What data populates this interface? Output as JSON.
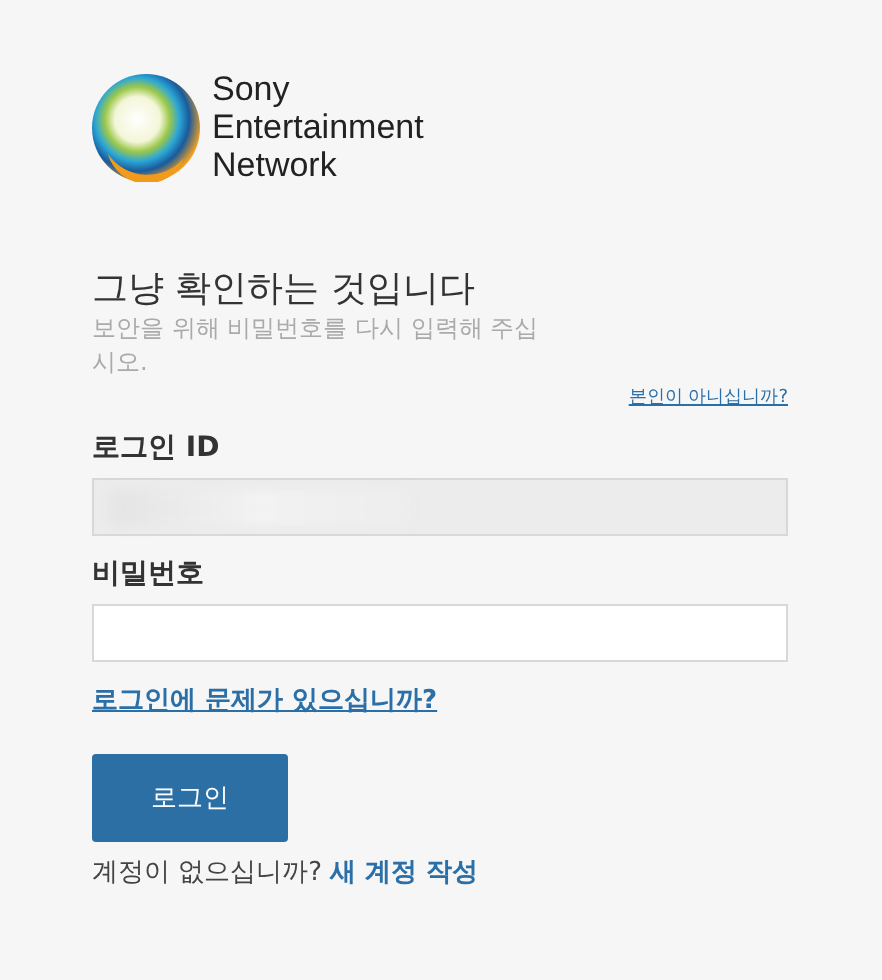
{
  "brand": {
    "lines": [
      "Sony",
      "Entertainment",
      "Network"
    ]
  },
  "heading": "그냥 확인하는 것입니다",
  "subtitle": "보안을 위해 비밀번호를 다시 입력해 주십시오.",
  "not_you_link": "본인이 아니십니까?",
  "fields": [
    {
      "label": "로그인 ID",
      "disabled": true,
      "masked": true
    },
    {
      "label": "비밀번호",
      "disabled": false,
      "masked": false
    }
  ],
  "trouble_link": "로그인에 문제가 있으십니까?",
  "login_button": "로그인",
  "signup": {
    "prompt": "계정이 없으십니까?",
    "link": "새 계정 작성"
  }
}
